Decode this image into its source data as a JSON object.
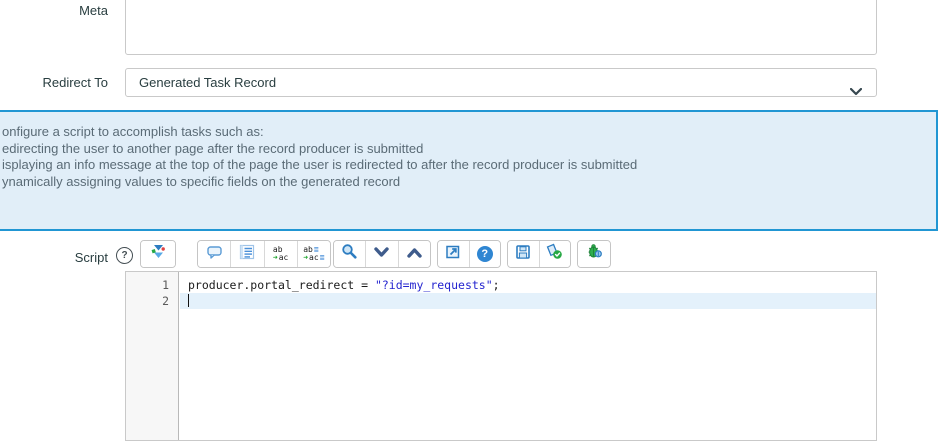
{
  "form": {
    "meta_label": "Meta",
    "redirect_label": "Redirect To",
    "redirect_value": "Generated Task Record",
    "script_label": "Script",
    "script_help_symbol": "?"
  },
  "info_box": {
    "lines": [
      "onfigure a script to accomplish tasks such as:",
      "edirecting the user to another page after the record producer is submitted",
      "isplaying an info message at the top of the page the user is redirected to after the record producer is submitted",
      "ynamically assigning values to specific fields on the generated record"
    ]
  },
  "toolbar": {
    "replace": {
      "top": "ab",
      "bottom": "ac"
    },
    "replace_all": {
      "top": "ab",
      "bottom": "ac"
    },
    "help_badge": "?",
    "icons": {
      "arrow_right": "➜",
      "lines": "≣"
    }
  },
  "editor": {
    "line_numbers": [
      "1",
      "2"
    ],
    "code": {
      "pre": "producer.portal_redirect = ",
      "string": "\"?id=my_requests\"",
      "post": ";"
    }
  },
  "colors": {
    "info_border": "#2196d3",
    "info_bg": "#e1eef8",
    "code_string_blue": "#2525cf",
    "active_line_bg": "#e4f1fb",
    "icon_blue": "#2d7dc1",
    "icon_green": "#27a844"
  }
}
